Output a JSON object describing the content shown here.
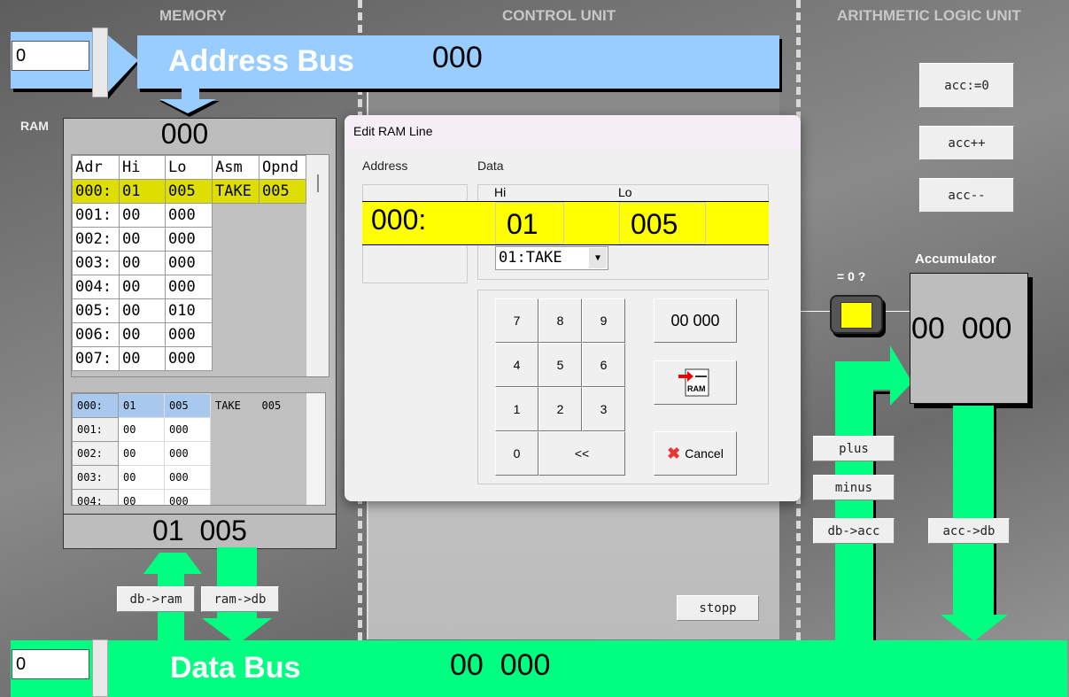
{
  "sections": {
    "memory": "MEMORY",
    "control": "CONTROL UNIT",
    "alu": "ARITHMETIC LOGIC UNIT"
  },
  "address_bus": {
    "input_value": "0",
    "label": "Address Bus",
    "value": "000"
  },
  "data_bus": {
    "input_value": "0",
    "label": "Data Bus",
    "value": "00  000"
  },
  "ram": {
    "label": "RAM",
    "address_display": "000",
    "data_display": "01  005",
    "headers": [
      "Adr",
      "Hi",
      "Lo",
      "Asm",
      "Opnd"
    ],
    "rows": [
      [
        "000:",
        "01",
        "005",
        "TAKE",
        "005"
      ],
      [
        "001:",
        "00",
        "000",
        "",
        ""
      ],
      [
        "002:",
        "00",
        "000",
        "",
        ""
      ],
      [
        "003:",
        "00",
        "000",
        "",
        ""
      ],
      [
        "004:",
        "00",
        "000",
        "",
        ""
      ],
      [
        "005:",
        "00",
        "010",
        "",
        ""
      ],
      [
        "006:",
        "00",
        "000",
        "",
        ""
      ],
      [
        "007:",
        "00",
        "000",
        "",
        ""
      ]
    ],
    "rows2": [
      [
        "000:",
        "01",
        "005",
        "TAKE",
        "005"
      ],
      [
        "001:",
        "00",
        "000",
        "",
        ""
      ],
      [
        "002:",
        "00",
        "000",
        "",
        ""
      ],
      [
        "003:",
        "00",
        "000",
        "",
        ""
      ],
      [
        "004:",
        "00",
        "000",
        "",
        ""
      ]
    ],
    "buttons": {
      "db_ram": "db->ram",
      "ram_db": "ram->db"
    }
  },
  "control": {
    "stop": "stopp"
  },
  "alu": {
    "acc_zero": "acc:=0",
    "acc_inc": "acc++",
    "acc_dec": "acc--",
    "zero_label": "= 0 ?",
    "acc_label": "Accumulator",
    "acc_value": "00  000",
    "plus": "plus",
    "minus": "minus",
    "db_acc": "db->acc",
    "acc_db": "acc->db"
  },
  "dialog": {
    "title": "Edit RAM Line",
    "address_label": "Address",
    "data_label": "Data",
    "hi_label": "Hi",
    "lo_label": "Lo",
    "address_value": "000:",
    "hi_value": "01",
    "lo_value": "005",
    "opcode_select": "01:TAKE",
    "keys": [
      "7",
      "8",
      "9",
      "4",
      "5",
      "6",
      "1",
      "2",
      "3",
      "0",
      "<<"
    ],
    "clear": "00 000",
    "ram_icon_text": "RAM",
    "cancel": "Cancel"
  },
  "colors": {
    "address_bus": "#99ccff",
    "data_bus": "#00ff80",
    "highlight": "#ffff00"
  }
}
